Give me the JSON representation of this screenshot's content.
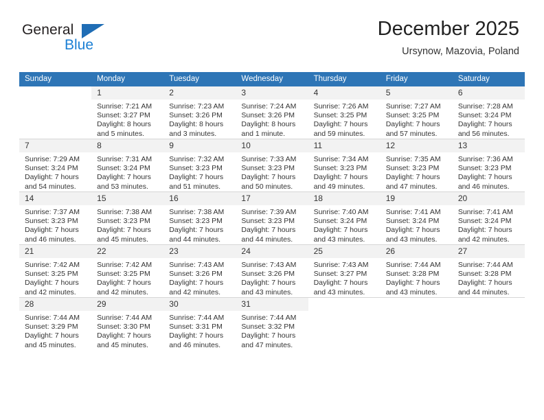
{
  "brand": {
    "name_part1": "General",
    "name_part2": "Blue"
  },
  "header": {
    "title": "December 2025",
    "subtitle": "Ursynow, Mazovia, Poland"
  },
  "weekday_headers": [
    "Sunday",
    "Monday",
    "Tuesday",
    "Wednesday",
    "Thursday",
    "Friday",
    "Saturday"
  ],
  "colors": {
    "header_blue": "#2e75b6",
    "brand_blue": "#1b7fd4",
    "daynum_band": "#f2f2f2",
    "grid_line": "#d6d6d6"
  },
  "weeks": [
    [
      {
        "day": "",
        "lines": []
      },
      {
        "day": "1",
        "lines": [
          "Sunrise: 7:21 AM",
          "Sunset: 3:27 PM",
          "Daylight: 8 hours",
          "and 5 minutes."
        ]
      },
      {
        "day": "2",
        "lines": [
          "Sunrise: 7:23 AM",
          "Sunset: 3:26 PM",
          "Daylight: 8 hours",
          "and 3 minutes."
        ]
      },
      {
        "day": "3",
        "lines": [
          "Sunrise: 7:24 AM",
          "Sunset: 3:26 PM",
          "Daylight: 8 hours",
          "and 1 minute."
        ]
      },
      {
        "day": "4",
        "lines": [
          "Sunrise: 7:26 AM",
          "Sunset: 3:25 PM",
          "Daylight: 7 hours",
          "and 59 minutes."
        ]
      },
      {
        "day": "5",
        "lines": [
          "Sunrise: 7:27 AM",
          "Sunset: 3:25 PM",
          "Daylight: 7 hours",
          "and 57 minutes."
        ]
      },
      {
        "day": "6",
        "lines": [
          "Sunrise: 7:28 AM",
          "Sunset: 3:24 PM",
          "Daylight: 7 hours",
          "and 56 minutes."
        ]
      }
    ],
    [
      {
        "day": "7",
        "lines": [
          "Sunrise: 7:29 AM",
          "Sunset: 3:24 PM",
          "Daylight: 7 hours",
          "and 54 minutes."
        ]
      },
      {
        "day": "8",
        "lines": [
          "Sunrise: 7:31 AM",
          "Sunset: 3:24 PM",
          "Daylight: 7 hours",
          "and 53 minutes."
        ]
      },
      {
        "day": "9",
        "lines": [
          "Sunrise: 7:32 AM",
          "Sunset: 3:23 PM",
          "Daylight: 7 hours",
          "and 51 minutes."
        ]
      },
      {
        "day": "10",
        "lines": [
          "Sunrise: 7:33 AM",
          "Sunset: 3:23 PM",
          "Daylight: 7 hours",
          "and 50 minutes."
        ]
      },
      {
        "day": "11",
        "lines": [
          "Sunrise: 7:34 AM",
          "Sunset: 3:23 PM",
          "Daylight: 7 hours",
          "and 49 minutes."
        ]
      },
      {
        "day": "12",
        "lines": [
          "Sunrise: 7:35 AM",
          "Sunset: 3:23 PM",
          "Daylight: 7 hours",
          "and 47 minutes."
        ]
      },
      {
        "day": "13",
        "lines": [
          "Sunrise: 7:36 AM",
          "Sunset: 3:23 PM",
          "Daylight: 7 hours",
          "and 46 minutes."
        ]
      }
    ],
    [
      {
        "day": "14",
        "lines": [
          "Sunrise: 7:37 AM",
          "Sunset: 3:23 PM",
          "Daylight: 7 hours",
          "and 46 minutes."
        ]
      },
      {
        "day": "15",
        "lines": [
          "Sunrise: 7:38 AM",
          "Sunset: 3:23 PM",
          "Daylight: 7 hours",
          "and 45 minutes."
        ]
      },
      {
        "day": "16",
        "lines": [
          "Sunrise: 7:38 AM",
          "Sunset: 3:23 PM",
          "Daylight: 7 hours",
          "and 44 minutes."
        ]
      },
      {
        "day": "17",
        "lines": [
          "Sunrise: 7:39 AM",
          "Sunset: 3:23 PM",
          "Daylight: 7 hours",
          "and 44 minutes."
        ]
      },
      {
        "day": "18",
        "lines": [
          "Sunrise: 7:40 AM",
          "Sunset: 3:24 PM",
          "Daylight: 7 hours",
          "and 43 minutes."
        ]
      },
      {
        "day": "19",
        "lines": [
          "Sunrise: 7:41 AM",
          "Sunset: 3:24 PM",
          "Daylight: 7 hours",
          "and 43 minutes."
        ]
      },
      {
        "day": "20",
        "lines": [
          "Sunrise: 7:41 AM",
          "Sunset: 3:24 PM",
          "Daylight: 7 hours",
          "and 42 minutes."
        ]
      }
    ],
    [
      {
        "day": "21",
        "lines": [
          "Sunrise: 7:42 AM",
          "Sunset: 3:25 PM",
          "Daylight: 7 hours",
          "and 42 minutes."
        ]
      },
      {
        "day": "22",
        "lines": [
          "Sunrise: 7:42 AM",
          "Sunset: 3:25 PM",
          "Daylight: 7 hours",
          "and 42 minutes."
        ]
      },
      {
        "day": "23",
        "lines": [
          "Sunrise: 7:43 AM",
          "Sunset: 3:26 PM",
          "Daylight: 7 hours",
          "and 42 minutes."
        ]
      },
      {
        "day": "24",
        "lines": [
          "Sunrise: 7:43 AM",
          "Sunset: 3:26 PM",
          "Daylight: 7 hours",
          "and 43 minutes."
        ]
      },
      {
        "day": "25",
        "lines": [
          "Sunrise: 7:43 AM",
          "Sunset: 3:27 PM",
          "Daylight: 7 hours",
          "and 43 minutes."
        ]
      },
      {
        "day": "26",
        "lines": [
          "Sunrise: 7:44 AM",
          "Sunset: 3:28 PM",
          "Daylight: 7 hours",
          "and 43 minutes."
        ]
      },
      {
        "day": "27",
        "lines": [
          "Sunrise: 7:44 AM",
          "Sunset: 3:28 PM",
          "Daylight: 7 hours",
          "and 44 minutes."
        ]
      }
    ],
    [
      {
        "day": "28",
        "lines": [
          "Sunrise: 7:44 AM",
          "Sunset: 3:29 PM",
          "Daylight: 7 hours",
          "and 45 minutes."
        ]
      },
      {
        "day": "29",
        "lines": [
          "Sunrise: 7:44 AM",
          "Sunset: 3:30 PM",
          "Daylight: 7 hours",
          "and 45 minutes."
        ]
      },
      {
        "day": "30",
        "lines": [
          "Sunrise: 7:44 AM",
          "Sunset: 3:31 PM",
          "Daylight: 7 hours",
          "and 46 minutes."
        ]
      },
      {
        "day": "31",
        "lines": [
          "Sunrise: 7:44 AM",
          "Sunset: 3:32 PM",
          "Daylight: 7 hours",
          "and 47 minutes."
        ]
      },
      {
        "day": "",
        "lines": []
      },
      {
        "day": "",
        "lines": []
      },
      {
        "day": "",
        "lines": []
      }
    ]
  ]
}
